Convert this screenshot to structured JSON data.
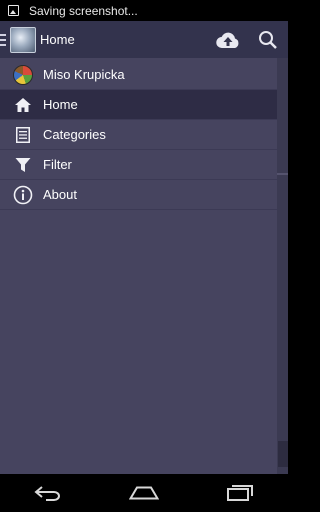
{
  "status_bar": {
    "notification_text": "Saving screenshot...",
    "icon": "screenshot-icon"
  },
  "action_bar": {
    "title": "Home",
    "icons": [
      "drawer-toggle-icon",
      "app-logo-icon",
      "cloud-upload-icon",
      "search-icon"
    ]
  },
  "drawer": {
    "items": [
      {
        "label": "Miso Krupicka",
        "icon": "avatar"
      },
      {
        "label": "Home",
        "icon": "home-icon",
        "active": true
      },
      {
        "label": "Categories",
        "icon": "list-icon"
      },
      {
        "label": "Filter",
        "icon": "filter-icon"
      },
      {
        "label": "About",
        "icon": "info-icon"
      }
    ]
  },
  "nav_bar": {
    "icons": [
      "back-icon",
      "home-nav-icon",
      "recents-icon"
    ]
  },
  "colors": {
    "action_bar": "#33334d",
    "drawer_bg": "#46445f",
    "active_item": "#2e2c45"
  }
}
